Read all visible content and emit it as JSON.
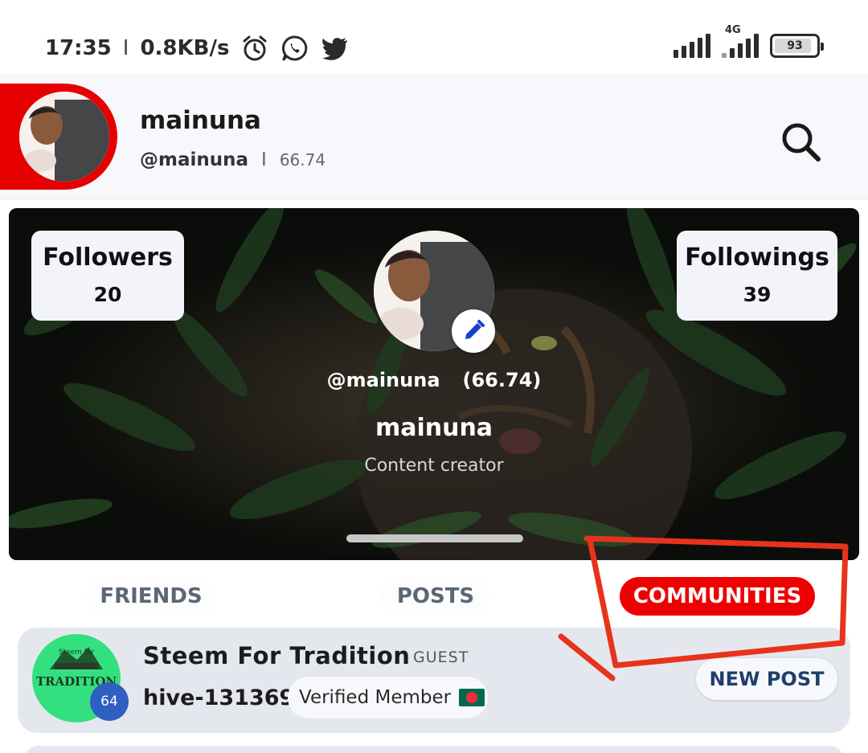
{
  "status_bar": {
    "time": "17:35",
    "separator": "I",
    "speed": "0.8KB/s",
    "network_type": "4G",
    "battery_level": "93",
    "icons": [
      "alarm-icon",
      "whatsapp-icon",
      "twitter-icon",
      "signal-icon",
      "signal-4g-icon",
      "battery-icon"
    ]
  },
  "header": {
    "name": "mainuna",
    "handle": "@mainuna",
    "separator": "I",
    "reputation": "66.74",
    "accent_color": "#e60000"
  },
  "profile": {
    "followers_label": "Followers",
    "followers_count": "20",
    "followings_label": "Followings",
    "followings_count": "39",
    "handle": "@mainuna",
    "reputation": "(66.74)",
    "name": "mainuna",
    "bio": "Content creator"
  },
  "tabs": [
    {
      "label": "FRIENDS",
      "active": false
    },
    {
      "label": "POSTS",
      "active": false
    },
    {
      "label": "COMMUNITIES",
      "active": true
    }
  ],
  "communities": [
    {
      "name": "Steem For Tradition",
      "role": "GUEST",
      "id": "hive-131369",
      "badge": "64",
      "logo_small": "Steem for",
      "logo_text": "TRADITION",
      "status": "Verified Member",
      "action": "NEW POST",
      "logo_color": "#33e07f"
    }
  ]
}
